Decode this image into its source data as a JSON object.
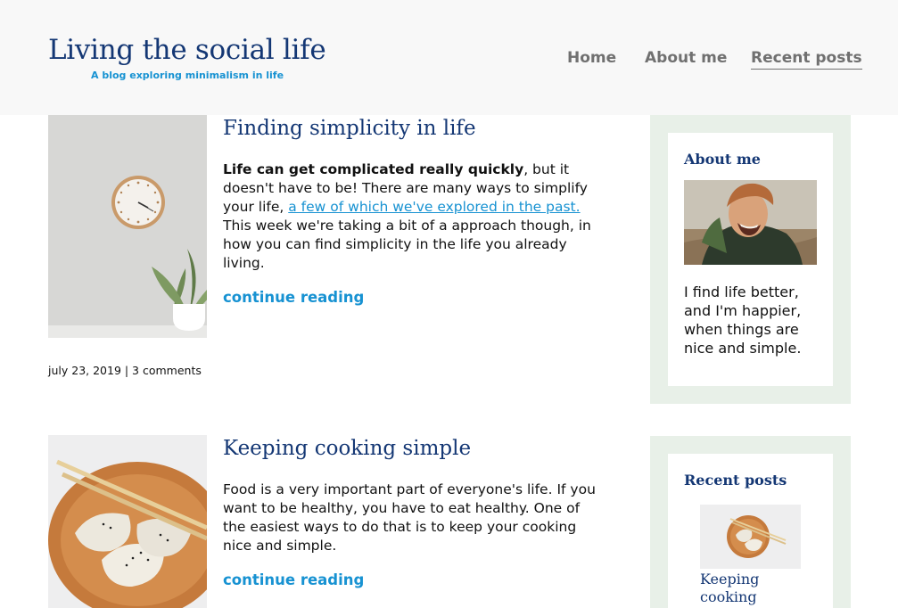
{
  "header": {
    "title": "Living the social life",
    "subtitle": "A blog exploring minimalism in life"
  },
  "nav": {
    "items": [
      {
        "label": "Home"
      },
      {
        "label": "About me"
      },
      {
        "label": "Recent posts",
        "active": true
      }
    ]
  },
  "posts": [
    {
      "title": "Finding simplicity in life",
      "body_bold": "Life can get complicated really quickly",
      "body_after_bold": ", but it doesn't have to be! There are many ways to simplify your life, ",
      "body_link": "a few of which we've explored in the past.",
      "body_end": " This week we're taking a bit of a approach though, in how you can find simplicity in the life you already living.",
      "continue_label": "continue reading",
      "meta": "july 23, 2019 | 3 comments",
      "image": "wall-clock-and-plant"
    },
    {
      "title": "Keeping cooking simple",
      "body": "Food is a very important part of everyone's life. If you want to be healthy, you have to eat healthy. One of the easiest ways to do that is to keep your cooking nice and simple.",
      "continue_label": "continue reading",
      "image": "dumplings-on-wooden-plate"
    }
  ],
  "sidebar": {
    "about": {
      "title": "About me",
      "text": "I find life better, and I'm happier, when things are nice and simple.",
      "image": "smiling-person-photo"
    },
    "recent": {
      "title": "Recent posts",
      "item_title": "Keeping cooking simple"
    }
  },
  "colors": {
    "brand": "#143774",
    "accent": "#1792d2",
    "header_bg": "#f8f8f8",
    "sidebar_bg": "#e8f0e8"
  }
}
